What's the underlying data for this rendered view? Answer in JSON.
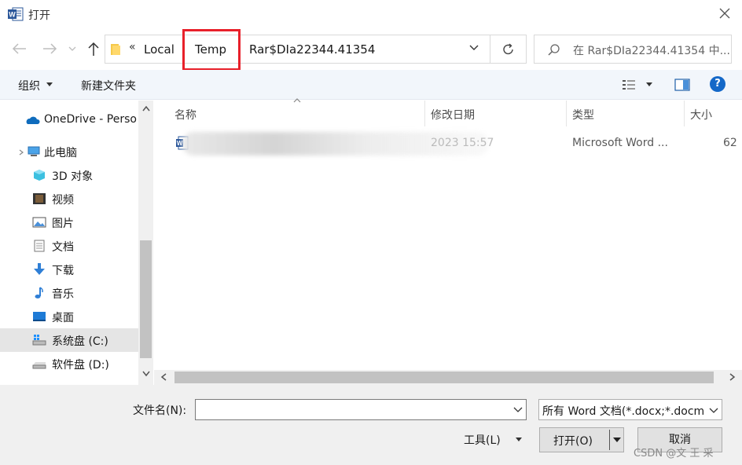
{
  "window": {
    "title": "打开",
    "app_icon": "word-icon"
  },
  "address_bar": {
    "overflow": "«",
    "crumbs": [
      "Local",
      "Temp",
      "Rar$DIa22344.41354"
    ],
    "highlighted_crumb": "Temp",
    "highlight_color": "#e8202a"
  },
  "search": {
    "placeholder": "在 Rar$DIa22344.41354 中..."
  },
  "toolbar": {
    "organize": "组织",
    "new_folder": "新建文件夹"
  },
  "sidebar": {
    "items": [
      {
        "label": "OneDrive - Perso",
        "icon": "onedrive-icon"
      },
      {
        "label": "此电脑",
        "icon": "computer-icon"
      },
      {
        "label": "3D 对象",
        "icon": "3d-objects-icon"
      },
      {
        "label": "视频",
        "icon": "video-icon"
      },
      {
        "label": "图片",
        "icon": "pictures-icon"
      },
      {
        "label": "文档",
        "icon": "documents-icon"
      },
      {
        "label": "下载",
        "icon": "download-icon"
      },
      {
        "label": "音乐",
        "icon": "music-icon"
      },
      {
        "label": "桌面",
        "icon": "desktop-icon"
      },
      {
        "label": "系统盘 (C:)",
        "icon": "drive-c-icon",
        "selected": true
      },
      {
        "label": "软件盘 (D:)",
        "icon": "drive-d-icon"
      }
    ]
  },
  "file_list": {
    "columns": [
      "名称",
      "修改日期",
      "类型",
      "大小"
    ],
    "rows": [
      {
        "name": "",
        "modified": "2023 15:57",
        "type": "Microsoft Word ...",
        "size": "62"
      }
    ]
  },
  "bottom": {
    "filename_label": "文件名(N):",
    "filename_value": "",
    "filter": "所有 Word 文档(*.docx;*.docm",
    "tools": "工具(L)",
    "open": "打开(O)",
    "cancel": "取消"
  },
  "watermark": "CSDN @文 王 采"
}
